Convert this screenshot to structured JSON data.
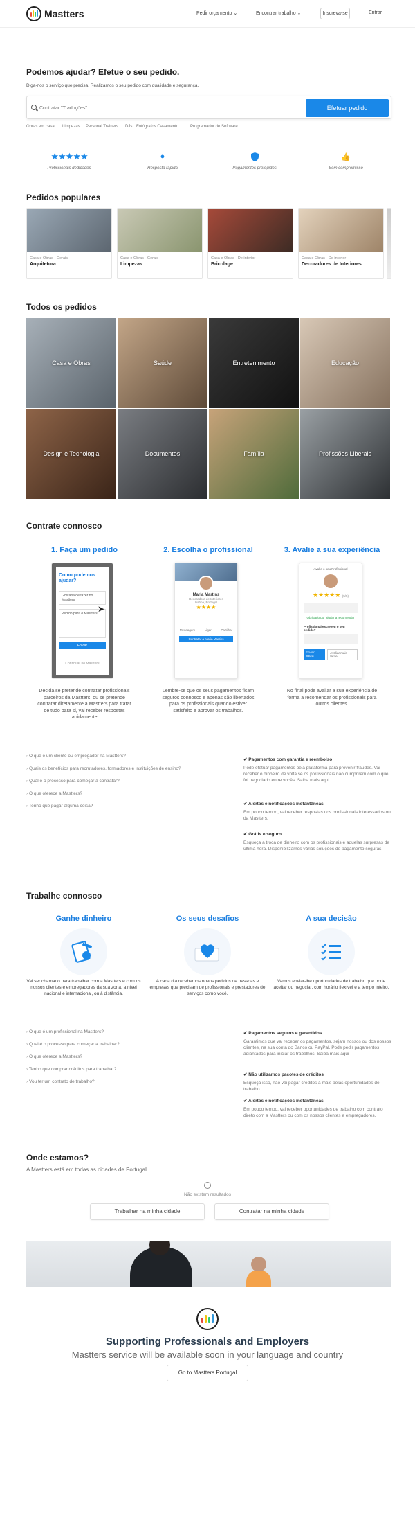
{
  "header": {
    "brand": "Mastters",
    "nav": [
      "Pedir orçamento",
      "Encontrar trabalho"
    ],
    "register": "Inscreva-se",
    "login": "Entrar"
  },
  "hero": {
    "title": "Podemos ajudar? Efetue o seu pedido.",
    "subtitle": "Diga-nos o serviço que precisa. Realizamos o seu pedido com qualidade e segurança.",
    "search_placeholder": "Contratar \"Traduções\"",
    "cta": "Efetuar pedido",
    "quick_links": [
      "Obras em casa",
      "Limpezas",
      "Personal Trainers",
      "DJs",
      "Fotógrafos Casamento",
      "Programador de Software"
    ]
  },
  "features": [
    {
      "icon": "stars-icon",
      "label": "Profissionais dedicados"
    },
    {
      "icon": "rocket-icon",
      "label": "Resposta rápida"
    },
    {
      "icon": "shield-icon",
      "label": "Pagamentos protegidos"
    },
    {
      "icon": "thumbs-up-icon",
      "label": "Sem compromisso"
    }
  ],
  "popular": {
    "title": "Pedidos populares",
    "items": [
      {
        "cat": "Casa e Obras - Gerais",
        "name": "Arquitetura",
        "color": "#6d7b8a"
      },
      {
        "cat": "Casa e Obras - Gerais",
        "name": "Limpezas",
        "color": "#9aa58a"
      },
      {
        "cat": "Casa e Obras - De interior",
        "name": "Bricolage",
        "color": "#7a4f3a"
      },
      {
        "cat": "Casa e Obras - De interior",
        "name": "Decoradores de Interiores",
        "color": "#b8a48c"
      }
    ]
  },
  "all": {
    "title": "Todos os pedidos",
    "categories": [
      {
        "label": "Casa e Obras",
        "color": "#7e8892"
      },
      {
        "label": "Saúde",
        "color": "#8a7560"
      },
      {
        "label": "Entretenimento",
        "color": "#2a2a2a"
      },
      {
        "label": "Educação",
        "color": "#a89786"
      },
      {
        "label": "Design e Tecnologia",
        "color": "#6a4a38"
      },
      {
        "label": "Documentos",
        "color": "#4a4d52"
      },
      {
        "label": "Família",
        "color": "#8e7454"
      },
      {
        "label": "Profissões Liberais",
        "color": "#5f6569"
      }
    ]
  },
  "hire": {
    "title": "Contrate connosco",
    "steps": [
      {
        "title": "1. Faça um pedido",
        "desc": "Decida se pretende contratar profissionais parceiros da Mastters, ou se pretende contratar diretamente a Mastters para tratar de tudo para si, vai receber respostas rapidamente."
      },
      {
        "title": "2. Escolha o profissional",
        "desc": "Lembre-se que os seus pagamentos ficam seguros connosco e apenas são libertados para os profissionais quando estiver satisfeito e aprovar os trabalhos."
      },
      {
        "title": "3. Avalie a sua experiência",
        "desc": "No final pode avaliar a sua experiência de forma a recomendar os profissionais para outros clientes."
      }
    ],
    "phone1": {
      "title": "Como podemos ajudar?",
      "l1": "Gostaria de fazer no Mastters",
      "l2": "Pedido para o Mastters",
      "btn": "Enviar",
      "l3": "Continuar no Mastters"
    },
    "phone2": {
      "name": "Maria Martins",
      "sub": "Decoradora de Interiores",
      "loc": "Lisboa, Portugal",
      "rating": "★★★★",
      "cta": "Contratar a Maria Martins",
      "icons": [
        "Mensagem",
        "Ligar",
        "Partilhar"
      ]
    },
    "phone3": {
      "q": "Avalie o seu Profissional",
      "stars": "★★★★★",
      "score": "(5/5)",
      "note": "Obrigado por ajudar a recomendar",
      "q2": "Profissional escreveu o seu pedido?",
      "b1": "Enviar agora",
      "b2": "Avaliar mais tarde"
    },
    "faq": [
      "O que é um cliente ou empregador na Mastters?",
      "Quais os benefícios para recrutadores, formadores e instituições de ensino?",
      "Qual é o processo para começar a contratar?",
      "O que oferece a Mastters?",
      "Tenho que pagar alguma coisa?"
    ],
    "benefits": [
      {
        "title": "Pagamentos com garantia e reembolso",
        "desc": "Pode efetuar pagamentos pela plataforma para prevenir fraudes. Vai receber o dinheiro de volta se os profissionais não cumprirem com o que foi negociado entre vocês. Saiba mais aqui"
      },
      {
        "title": "Alertas e notificações instantâneas",
        "desc": "Em pouco tempo, vai receber respostas dos profissionais interessados ou da Mastters."
      },
      {
        "title": "Grátis e seguro",
        "desc": "Esqueça a troca de dinheiro com os profissionais e aquelas surpresas de última hora. Disponibilizamos várias soluções de pagamento seguras."
      }
    ]
  },
  "work": {
    "title": "Trabalhe connosco",
    "cols": [
      {
        "title": "Ganhe dinheiro",
        "icon": "money-icon",
        "desc": "Vai ser chamado para trabalhar com a Mastters e com os nossos clientes e empregadores da sua zona, a nível nacional e internacional, ou à distância."
      },
      {
        "title": "Os seus desafios",
        "icon": "heart-icon",
        "desc": "A cada dia recebemos novos pedidos de pessoas e empresas que precisam de profissionais e prestadores de serviços como você."
      },
      {
        "title": "A sua decisão",
        "icon": "checklist-icon",
        "desc": "Vamos enviar-lhe oportunidades de trabalho que pode aceitar ou negociar, com horário flexível e a tempo inteiro."
      }
    ],
    "faq": [
      "O que é um profissional na Mastters?",
      "Qual é o processo para começar a trabalhar?",
      "O que oferece a Mastters?",
      "Tenho que comprar créditos para trabalhar?",
      "Vou ter um contrato de trabalho?"
    ],
    "benefits": [
      {
        "title": "Pagamentos seguros e garantidos",
        "desc": "Garantimos que vai receber os pagamentos, sejam nossos ou dos nossos clientes, na sua conta do Banco ou PayPal. Pode pedir pagamentos adiantados para iniciar os trabalhos. Saiba mais aqui"
      },
      {
        "title": "Não utilizamos pacotes de créditos",
        "desc": "Esqueça isso, não vai pagar créditos a mais pelas oportunidades de trabalho."
      },
      {
        "title": "Alertas e notificações instantâneas",
        "desc": "Em pouco tempo, vai receber oportunidades de trabalho com contrato direto com a Mastters ou com os nossos clientes e empregadores."
      }
    ]
  },
  "where": {
    "title": "Onde estamos?",
    "subtitle": "A Mastters está em todas as cidades de Portugal",
    "empty": "Não existem resultados",
    "btn_work": "Trabalhar na minha cidade",
    "btn_hire": "Contratar na minha cidade"
  },
  "footer": {
    "title": "Supporting Professionals and Employers",
    "subtitle": "Mastters service will be available soon in your language and country",
    "button": "Go to Mastters Portugal"
  },
  "colors": {
    "accent": "#1a88e8",
    "logo_bars": [
      "#e84c3d",
      "#f1c40f",
      "#2ecc71",
      "#3498db"
    ]
  }
}
